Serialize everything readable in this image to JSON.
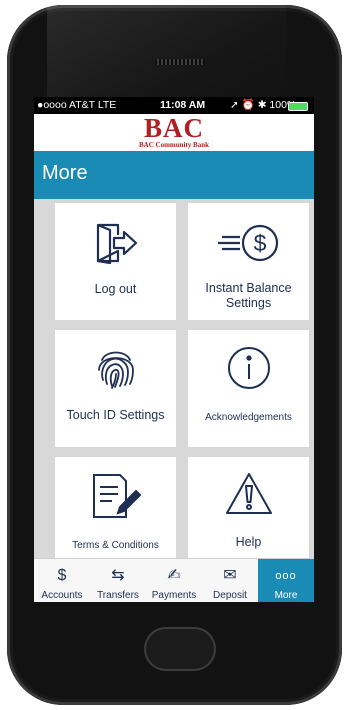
{
  "status_bar": {
    "carrier": "●oooo AT&T  LTE",
    "time": "11:08 AM",
    "icons": "➚ ⏰ ✱ 100%"
  },
  "brand": {
    "name": "BAC",
    "subtitle": "BAC Community Bank",
    "color": "#b01f24"
  },
  "header": {
    "title": "More",
    "color": "#1a8bb5"
  },
  "tiles": [
    {
      "label": "Log out",
      "icon": "logout-icon"
    },
    {
      "label": "Instant Balance Settings",
      "icon": "instant-balance-icon"
    },
    {
      "label": "Touch ID Settings",
      "icon": "fingerprint-icon"
    },
    {
      "label": "Acknowledgements",
      "icon": "info-icon"
    },
    {
      "label": "Terms & Conditions",
      "icon": "document-pen-icon"
    },
    {
      "label": "Help",
      "icon": "warning-icon"
    }
  ],
  "tabs": [
    {
      "label": "Accounts",
      "icon": "dollar-icon",
      "glyph": "$"
    },
    {
      "label": "Transfers",
      "icon": "transfer-icon",
      "glyph": "⇆"
    },
    {
      "label": "Payments",
      "icon": "payments-icon",
      "glyph": "✍"
    },
    {
      "label": "Deposit",
      "icon": "deposit-icon",
      "glyph": "✉"
    },
    {
      "label": "More",
      "icon": "more-icon",
      "glyph": "ooo"
    }
  ],
  "active_tab": "More"
}
